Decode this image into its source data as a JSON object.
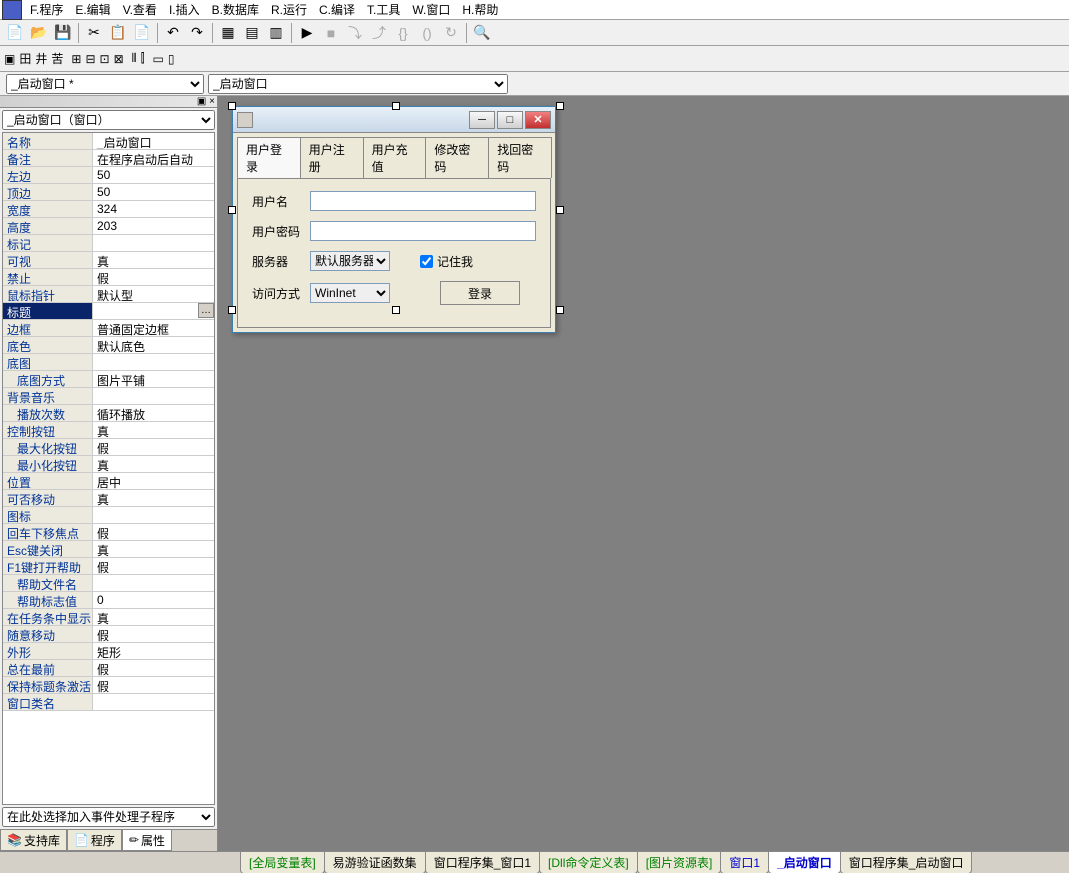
{
  "menu": [
    "F.程序",
    "E.编辑",
    "V.查看",
    "I.插入",
    "B.数据库",
    "R.运行",
    "C.编译",
    "T.工具",
    "W.窗口",
    "H.帮助"
  ],
  "combo1": "_启动窗口 *",
  "combo2": "_启动窗口",
  "prop_combo": "_启动窗口（窗口）",
  "props": [
    {
      "k": "名称",
      "v": "_启动窗口"
    },
    {
      "k": "备注",
      "v": "在程序启动后自动"
    },
    {
      "k": "左边",
      "v": "50"
    },
    {
      "k": "顶边",
      "v": "50"
    },
    {
      "k": "宽度",
      "v": "324"
    },
    {
      "k": "高度",
      "v": "203"
    },
    {
      "k": "标记",
      "v": ""
    },
    {
      "k": "可视",
      "v": "真"
    },
    {
      "k": "禁止",
      "v": "假"
    },
    {
      "k": "鼠标指针",
      "v": "默认型"
    },
    {
      "k": "标题",
      "v": "",
      "sel": true,
      "dots": true
    },
    {
      "k": "边框",
      "v": "普通固定边框"
    },
    {
      "k": "底色",
      "v": "默认底色"
    },
    {
      "k": "底图",
      "v": ""
    },
    {
      "k": "底图方式",
      "v": "图片平铺",
      "indent": true
    },
    {
      "k": "背景音乐",
      "v": ""
    },
    {
      "k": "播放次数",
      "v": "循环播放",
      "indent": true
    },
    {
      "k": "控制按钮",
      "v": "真"
    },
    {
      "k": "最大化按钮",
      "v": "假",
      "indent": true
    },
    {
      "k": "最小化按钮",
      "v": "真",
      "indent": true
    },
    {
      "k": "位置",
      "v": "居中"
    },
    {
      "k": "可否移动",
      "v": "真"
    },
    {
      "k": "图标",
      "v": ""
    },
    {
      "k": "回车下移焦点",
      "v": "假"
    },
    {
      "k": "Esc键关闭",
      "v": "真"
    },
    {
      "k": "F1键打开帮助",
      "v": "假"
    },
    {
      "k": "帮助文件名",
      "v": "",
      "indent": true
    },
    {
      "k": "帮助标志值",
      "v": "0",
      "indent": true
    },
    {
      "k": "在任务条中显示",
      "v": "真"
    },
    {
      "k": "随意移动",
      "v": "假"
    },
    {
      "k": "外形",
      "v": "矩形"
    },
    {
      "k": "总在最前",
      "v": "假"
    },
    {
      "k": "保持标题条激活",
      "v": "假"
    },
    {
      "k": "窗口类名",
      "v": ""
    }
  ],
  "event_combo": "在此处选择加入事件处理子程序",
  "left_tabs": [
    "支持库",
    "程序",
    "属性"
  ],
  "form": {
    "tabs": [
      "用户登录",
      "用户注册",
      "用户充值",
      "修改密码",
      "找回密码"
    ],
    "username_label": "用户名",
    "password_label": "用户密码",
    "server_label": "服务器",
    "server_value": "默认服务器",
    "access_label": "访问方式",
    "access_value": "WinInet",
    "remember": "记住我",
    "login": "登录"
  },
  "bottom_tabs": [
    {
      "t": "[全局变量表]",
      "c": "green"
    },
    {
      "t": "易游验证函数集",
      "c": ""
    },
    {
      "t": "窗口程序集_窗口1",
      "c": ""
    },
    {
      "t": "[Dll命令定义表]",
      "c": "green"
    },
    {
      "t": "[图片资源表]",
      "c": "green"
    },
    {
      "t": "窗口1",
      "c": "blue"
    },
    {
      "t": "_启动窗口",
      "c": "blue",
      "active": true
    },
    {
      "t": "窗口程序集_启动窗口",
      "c": ""
    }
  ]
}
